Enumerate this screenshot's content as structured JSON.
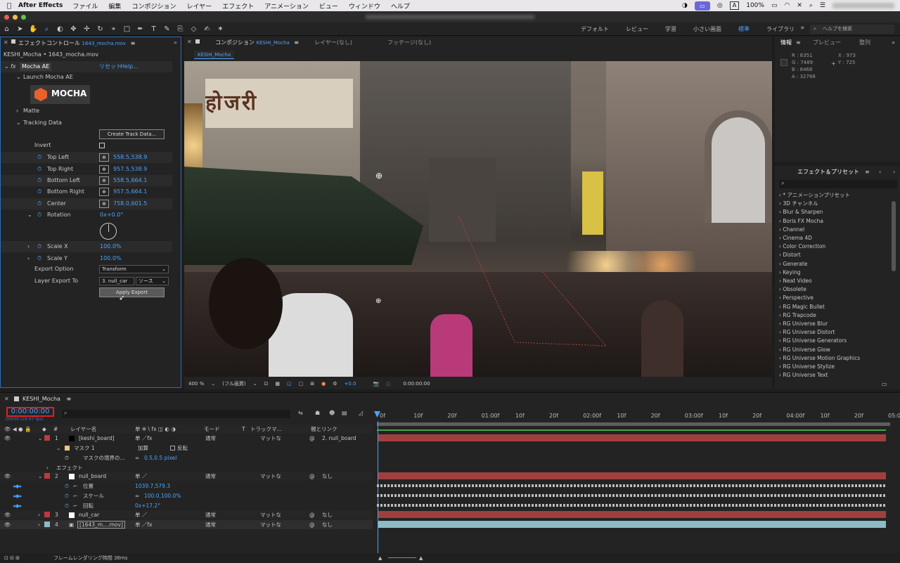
{
  "menubar": {
    "app": "After Effects",
    "items": [
      "ファイル",
      "編集",
      "コンポジション",
      "レイヤー",
      "エフェクト",
      "アニメーション",
      "ビュー",
      "ウィンドウ",
      "ヘルプ"
    ],
    "battery": "100%",
    "input_indicator": "A"
  },
  "toolbar": {
    "workspaces": [
      "デフォルト",
      "レビュー",
      "学習",
      "小さい画面",
      "標準",
      "ライブラリ"
    ],
    "active_workspace": "標準",
    "help_placeholder": "ヘルプを検索"
  },
  "effect_controls": {
    "tab": "エフェクトコントロール",
    "tab_file": "1643_mocha.mov",
    "layer_path": "KESHI_Mocha • 1643_mocha.mov",
    "effect_name": "Mocha AE",
    "reset": "リセット",
    "help": "Help...",
    "launch": "Launch Mocha AE",
    "logo": "MOCHA",
    "matte": "Matte",
    "tracking_data": "Tracking Data",
    "create_track": "Create Track Data...",
    "invert": "Invert",
    "points": [
      {
        "label": "Top Left",
        "value": "558.5,538.9"
      },
      {
        "label": "Top Right",
        "value": "957.5,538.9"
      },
      {
        "label": "Bottom Left",
        "value": "558.5,664.1"
      },
      {
        "label": "Bottom Right",
        "value": "957.5,664.1"
      },
      {
        "label": "Center",
        "value": "758.0,601.5"
      }
    ],
    "rotation_label": "Rotation",
    "rotation_value": "0x+0.0°",
    "scale_x_label": "Scale X",
    "scale_x_value": "100.0%",
    "scale_y_label": "Scale Y",
    "scale_y_value": "100.0%",
    "export_option_label": "Export Option",
    "export_option_value": "Transform",
    "layer_export_label": "Layer Export To",
    "layer_export_value": "3. null_car",
    "layer_export_source": "ソース",
    "apply_export": "Apply Export"
  },
  "composition": {
    "tab": "コンポジション",
    "tab_name": "KESHI_Mocha",
    "layer_tab": "レイヤー(なし)",
    "footage_tab": "フッテージ(なし)",
    "subtab": "KESHI_Mocha",
    "zoom": "400 %",
    "resolution": "(フル画質)",
    "exposure": "+0.0",
    "timecode": "0:00:00:00"
  },
  "info": {
    "tabs": [
      "情報",
      "プレビュー",
      "整列"
    ],
    "r": "R : 8351",
    "g": "G : 7489",
    "b": "B : 8468",
    "a": "A : 32768",
    "x": "X : 973",
    "y": "Y : 725"
  },
  "fx_presets": {
    "title": "エフェクト＆プリセット",
    "items": [
      "* アニメーションプリセット",
      "3D チャンネル",
      "Blur & Sharpen",
      "Boris FX Mocha",
      "Channel",
      "Cinema 4D",
      "Color Correction",
      "Distort",
      "Generate",
      "Keying",
      "Neat Video",
      "Obsolete",
      "Perspective",
      "RG Magic Bullet",
      "RG Trapcode",
      "RG Universe Blur",
      "RG Universe Distort",
      "RG Universe Generators",
      "RG Universe Glow",
      "RG Universe Motion Graphics",
      "RG Universe Stylize",
      "RG Universe Text"
    ]
  },
  "timeline": {
    "tab": "KESHI_Mocha",
    "timecode": "0:00:00:00",
    "fps": "00000 (29.97 fps)",
    "col_layer": "レイヤー名",
    "col_mode": "モード",
    "col_t": "T",
    "col_track": "トラックマ...",
    "col_parent": "親とリンク",
    "ruler": [
      "0f",
      "10f",
      "20f",
      "01:00f",
      "10f",
      "20f",
      "02:00f",
      "10f",
      "20f",
      "03:00f",
      "10f",
      "20f",
      "04:00f",
      "10f",
      "20f",
      "05:0"
    ],
    "layers": [
      {
        "num": "1",
        "name": "[keshi_board]",
        "mode": "通常",
        "track": "マットな",
        "parent": "2. null_board",
        "color": "#c0393b"
      },
      {
        "num": "2",
        "name": "null_board",
        "mode": "通常",
        "track": "マットな",
        "parent": "なし",
        "color": "#c0393b"
      },
      {
        "num": "3",
        "name": "null_car",
        "mode": "通常",
        "track": "マットな",
        "parent": "なし",
        "color": "#c0393b"
      },
      {
        "num": "4",
        "name": "[1643_m....mov]",
        "mode": "通常",
        "track": "マットな",
        "parent": "なし",
        "color": "#8fb9c4"
      }
    ],
    "mask": "マスク 1",
    "mask_mode": "加算",
    "mask_invert": "反転",
    "mask_feather_label": "マスクの境界の...",
    "mask_feather_value": "0.5,0.5 pixel",
    "effects": "エフェクト",
    "position_label": "位置",
    "position_value": "1039.7,579.3",
    "scale_label": "スケール",
    "scale_value": "100.0,100.0%",
    "rotation_label": "回転",
    "rotation_value": "0x+17.2°",
    "render_time": "フレームレンダリング時間 36ms"
  }
}
